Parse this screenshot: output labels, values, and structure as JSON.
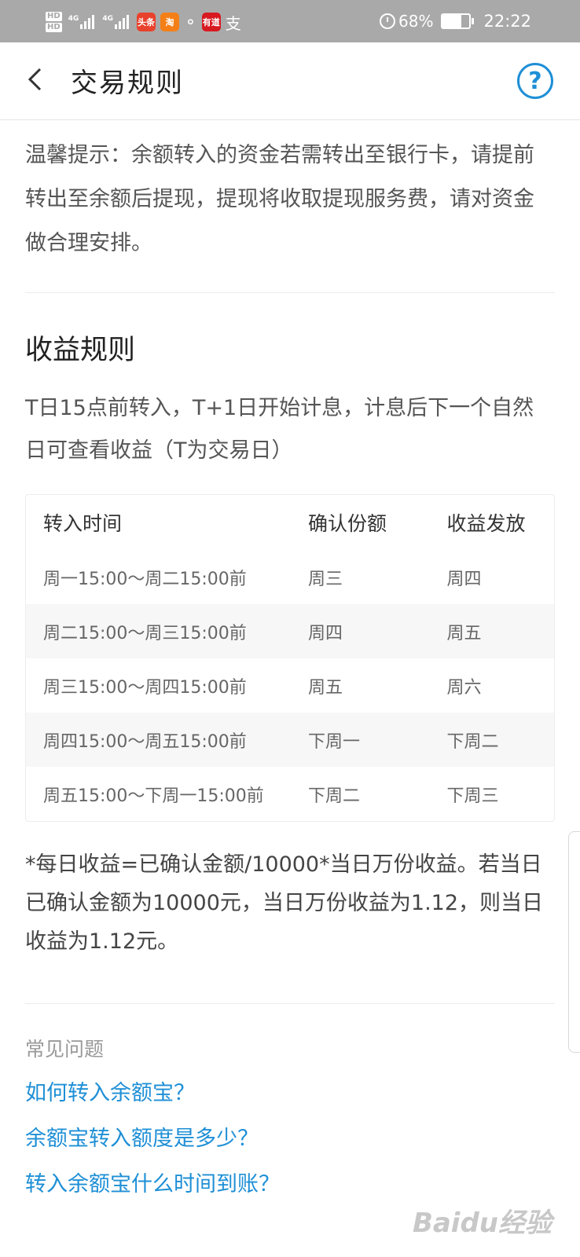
{
  "status_bar": {
    "hd1": "HD",
    "hd2": "HD",
    "net1": "4G",
    "net2": "4G",
    "app_toutiao": "头条",
    "app_taobao": "淘",
    "app_youdao": "有道",
    "alipay_glyph": "支",
    "battery": "68%",
    "battery_level": 0.68,
    "time": "22:22"
  },
  "nav": {
    "title": "交易规则",
    "help_glyph": "?"
  },
  "tip": {
    "text": "温馨提示：余额转入的资金若需转出至银行卡，请提前转出至余额后提现，提现将收取提现服务费，请对资金做合理安排。"
  },
  "income_rules": {
    "title": "收益规则",
    "description": "T日15点前转入，T+1日开始计息，计息后下一个自然日可查看收益（T为交易日）",
    "table": {
      "headers": [
        "转入时间",
        "确认份额",
        "收益发放"
      ],
      "rows": [
        [
          "周一15:00～周二15:00前",
          "周三",
          "周四"
        ],
        [
          "周二15:00～周三15:00前",
          "周四",
          "周五"
        ],
        [
          "周三15:00～周四15:00前",
          "周五",
          "周六"
        ],
        [
          "周四15:00～周五15:00前",
          "下周一",
          "下周二"
        ],
        [
          "周五15:00～下周一15:00前",
          "下周二",
          "下周三"
        ]
      ]
    },
    "formula": "*每日收益=已确认金额/10000*当日万份收益。若当日已确认金额为10000元，当日万份收益为1.12，则当日收益为1.12元。"
  },
  "faq": {
    "title": "常见问题",
    "links": [
      "如何转入余额宝？",
      "余额宝转入额度是多少？",
      "转入余额宝什么时间到账？"
    ]
  },
  "watermark": "Baidu经验",
  "colors": {
    "link": "#1e8fd6",
    "status_bar_bg": "#a9a9a9"
  }
}
